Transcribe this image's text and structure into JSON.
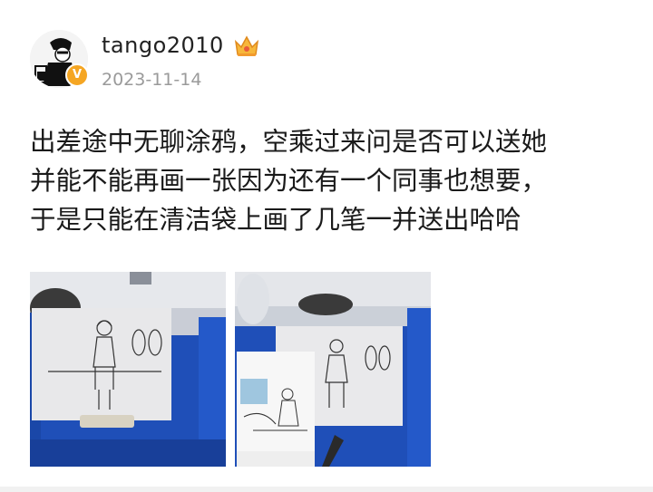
{
  "post": {
    "username": "tango2010",
    "date": "2023-11-14",
    "text_lines": [
      "出差途中无聊涂鸦，空乘过来问是否可以送她",
      "并能不能再画一张因为还有一个同事也想要，",
      "于是只能在清洁袋上画了几笔一并送出哈哈"
    ],
    "verified_badge": "V",
    "badge_icon": "crown-icon"
  },
  "photos": [
    {
      "name": "seat-headrest-drawing-photo"
    },
    {
      "name": "cleaning-bag-drawing-photo"
    }
  ],
  "colors": {
    "badge": "#f5a623",
    "seat_blue": "#1f4fb8",
    "text": "#1a1a1a",
    "date": "#9a9a9a"
  }
}
